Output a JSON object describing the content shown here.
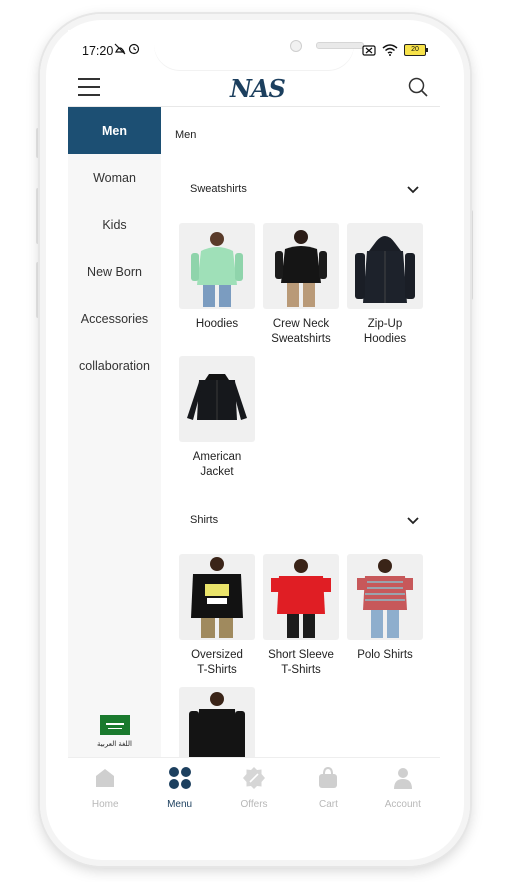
{
  "status": {
    "time": "17:20"
  },
  "header": {
    "logo": "NAS"
  },
  "nav": {
    "items": [
      {
        "label": "Men"
      },
      {
        "label": "Woman"
      },
      {
        "label": "Kids"
      },
      {
        "label": "New Born"
      },
      {
        "label": "Accessories"
      },
      {
        "label": "collaboration"
      }
    ],
    "language_label": "اللغة العربية"
  },
  "content": {
    "breadcrumb": "Men",
    "sections": [
      {
        "title": "Sweatshirts",
        "items": [
          {
            "label_1": "Hoodies",
            "label_2": ""
          },
          {
            "label_1": "Crew Neck",
            "label_2": "Sweatshirts"
          },
          {
            "label_1": "Zip-Up",
            "label_2": "Hoodies"
          },
          {
            "label_1": "American",
            "label_2": "Jacket"
          }
        ]
      },
      {
        "title": "Shirts",
        "items": [
          {
            "label_1": "Oversized",
            "label_2": "T-Shirts"
          },
          {
            "label_1": "Short Sleeve",
            "label_2": "T-Shirts"
          },
          {
            "label_1": "Polo Shirts",
            "label_2": ""
          },
          {
            "label_1": "",
            "label_2": ""
          }
        ]
      }
    ]
  },
  "bottom_nav": {
    "tabs": [
      {
        "label": "Home"
      },
      {
        "label": "Menu"
      },
      {
        "label": "Offers"
      },
      {
        "label": "Cart"
      },
      {
        "label": "Account"
      }
    ]
  },
  "colors": {
    "brand": "#1c4f73",
    "inactive_tab": "#b8b8b8",
    "thumb_bg": "#f0f0f0"
  }
}
